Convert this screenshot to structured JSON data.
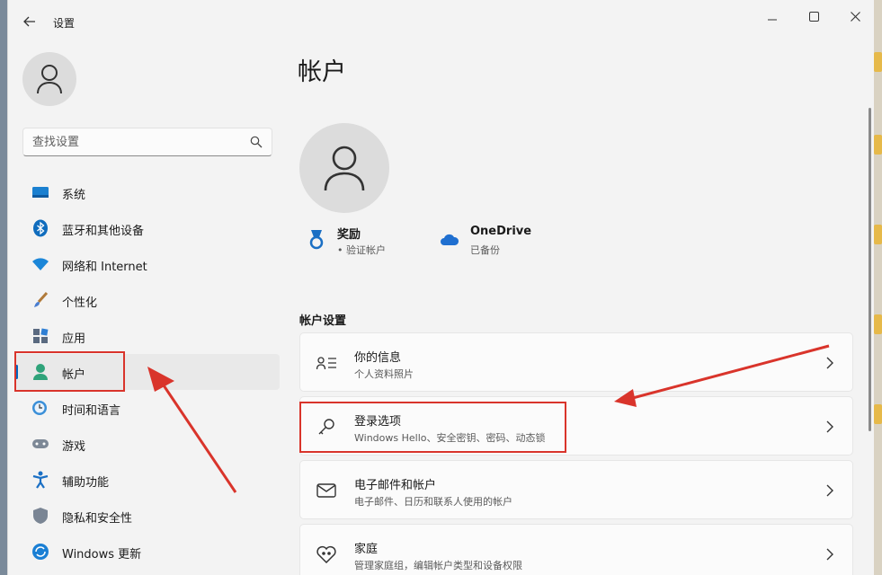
{
  "window": {
    "title": "设置"
  },
  "sidebar": {
    "search_placeholder": "查找设置",
    "items": [
      {
        "label": "系统",
        "icon": "system-icon"
      },
      {
        "label": "蓝牙和其他设备",
        "icon": "bluetooth-icon"
      },
      {
        "label": "网络和 Internet",
        "icon": "wifi-icon"
      },
      {
        "label": "个性化",
        "icon": "brush-icon"
      },
      {
        "label": "应用",
        "icon": "apps-icon"
      },
      {
        "label": "帐户",
        "icon": "account-icon",
        "active": true
      },
      {
        "label": "时间和语言",
        "icon": "clock-globe-icon"
      },
      {
        "label": "游戏",
        "icon": "gamepad-icon"
      },
      {
        "label": "辅助功能",
        "icon": "accessibility-icon"
      },
      {
        "label": "隐私和安全性",
        "icon": "shield-icon"
      },
      {
        "label": "Windows 更新",
        "icon": "update-icon"
      }
    ]
  },
  "main": {
    "title": "帐户",
    "rewards": {
      "title": "奖励",
      "subtitle": "• 验证帐户"
    },
    "onedrive": {
      "title": "OneDrive",
      "subtitle": "已备份"
    },
    "section_title": "帐户设置",
    "cards": [
      {
        "title": "你的信息",
        "subtitle": "个人资料照片",
        "icon": "person-list-icon"
      },
      {
        "title": "登录选项",
        "subtitle": "Windows Hello、安全密钥、密码、动态锁",
        "icon": "key-icon"
      },
      {
        "title": "电子邮件和帐户",
        "subtitle": "电子邮件、日历和联系人使用的帐户",
        "icon": "mail-icon"
      },
      {
        "title": "家庭",
        "subtitle": "管理家庭组，编辑帐户类型和设备权限",
        "icon": "family-heart-icon"
      }
    ]
  },
  "colors": {
    "accent": "#0067c0",
    "annotation": "#d9342b"
  }
}
